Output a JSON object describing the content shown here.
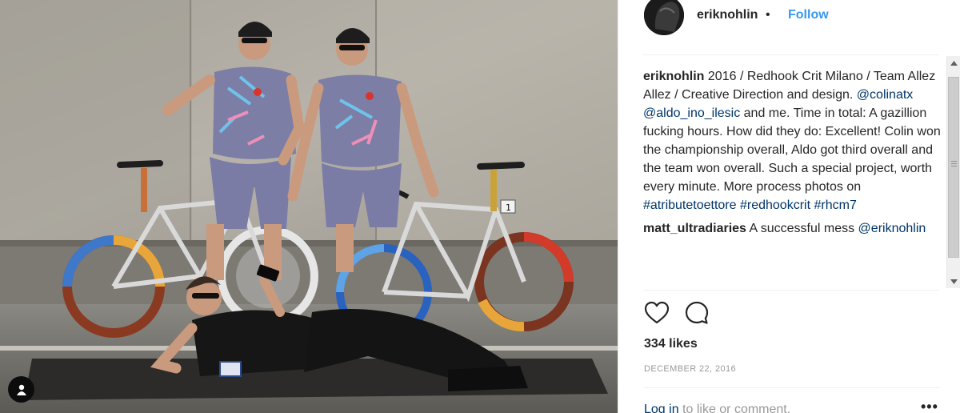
{
  "post": {
    "username": "eriknohlin",
    "separator": "•",
    "follow_label": "Follow",
    "avatar_alt": "eriknohlin profile picture"
  },
  "caption": {
    "author": "eriknohlin",
    "text_1": " 2016 / Redhook Crit Milano / Team Allez Allez / Creative Direction and design. ",
    "mention_1": "@colinatx",
    "text_2": " ",
    "mention_2": "@aldo_ino_ilesic",
    "text_3": " and me. Time in total: A gazillion fucking hours. How did they do: Excellent! Colin won the championship overall, Aldo got third overall and the team won overall. Such a special project, worth every minute. More process photos on ",
    "hashtag_1": "#atributetoettore",
    "text_4": " ",
    "hashtag_2": "#redhookcrit",
    "text_5": " ",
    "hashtag_3": "#rhcm7"
  },
  "comments": [
    {
      "author": "matt_ultradiaries",
      "text": " A successful mess ",
      "mention": "@eriknohlin"
    }
  ],
  "actions": {
    "like_icon": "heart-icon",
    "comment_icon": "speech-bubble-icon"
  },
  "likes_text": "334 likes",
  "date_text": "DECEMBER 22, 2016",
  "footer": {
    "login_link": "Log in",
    "login_rest": " to like or comment.",
    "more_label": "•••"
  },
  "photo": {
    "bib_number": "1",
    "user_tag_icon": "person-icon"
  },
  "colors": {
    "link": "#003569",
    "follow": "#3897f0",
    "muted": "#999999",
    "text": "#262626"
  }
}
